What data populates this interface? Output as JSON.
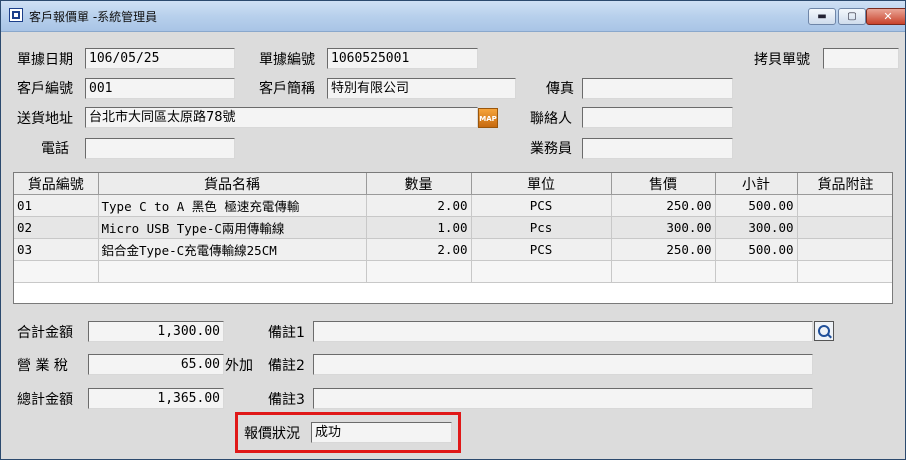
{
  "window": {
    "title": "客戶報價單 -系統管理員",
    "minimize_label": "▬",
    "maximize_label": "▢",
    "close_label": "✕"
  },
  "header": {
    "doc_date_label": "單據日期",
    "doc_date": "106/05/25",
    "doc_no_label": "單據編號",
    "doc_no": "1060525001",
    "copy_no_label": "拷貝單號",
    "copy_no": "",
    "customer_code_label": "客戶編號",
    "customer_code": "001",
    "customer_name_label": "客戶簡稱",
    "customer_name": "特別有限公司",
    "fax_label": "傳真",
    "fax": "",
    "address_label": "送貨地址",
    "address": "台北市大同區太原路78號",
    "map_label": "MAP",
    "contact_label": "聯絡人",
    "contact": "",
    "phone_label": "電話",
    "phone": "",
    "salesperson_label": "業務員",
    "salesperson": ""
  },
  "grid": {
    "columns": [
      "貨品編號",
      "貨品名稱",
      "數量",
      "單位",
      "售價",
      "小計",
      "貨品附註"
    ],
    "rows": [
      {
        "code": "01",
        "name": "Type C to A 黑色 極速充電傳輸",
        "qty": "2.00",
        "unit": "PCS",
        "price": "250.00",
        "subtotal": "500.00",
        "note": ""
      },
      {
        "code": "02",
        "name": "Micro USB Type-C兩用傳輸線",
        "qty": "1.00",
        "unit": "Pcs",
        "price": "300.00",
        "subtotal": "300.00",
        "note": ""
      },
      {
        "code": "03",
        "name": "鋁合金Type-C充電傳輸線25CM",
        "qty": "2.00",
        "unit": "PCS",
        "price": "250.00",
        "subtotal": "500.00",
        "note": ""
      }
    ]
  },
  "footer": {
    "total_label": "合計金額",
    "total": "1,300.00",
    "tax_label": "營 業 稅",
    "tax": "65.00",
    "tax_mode": "外加",
    "grand_total_label": "總計金額",
    "grand_total": "1,365.00",
    "note1_label": "備註1",
    "note1": "",
    "note2_label": "備註2",
    "note2": "",
    "note3_label": "備註3",
    "note3": "",
    "status_label": "報價狀況",
    "status": "成功"
  }
}
